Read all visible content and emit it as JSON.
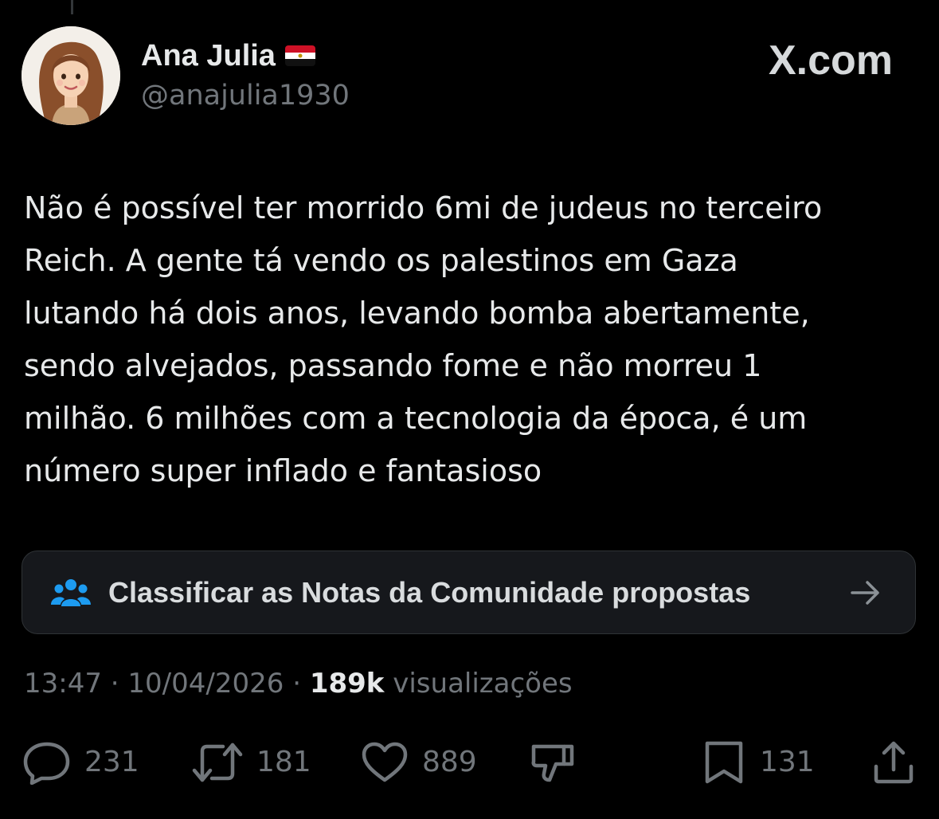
{
  "post": {
    "display_name": "Ana Julia",
    "handle": "@anajulia1930",
    "brand": "X.com",
    "text": "Não é possível ter morrido 6mi de judeus no terceiro\nReich. A gente tá vendo os palestinos em Gaza\nlutando há dois anos, levando bomba abertamente,\nsendo alvejados, passando fome e não morreu 1\nmilhão. 6 milhões com a tecnologia da época, é um\nnúmero super inflado e fantasioso"
  },
  "community_notes": {
    "label": "Classificar as Notas da Comunidade propostas"
  },
  "meta": {
    "time": "13:47",
    "separator": "·",
    "date": "10/04/2026",
    "views_count": "189k",
    "views_label": "visualizações"
  },
  "actions": {
    "replies": "231",
    "reposts": "181",
    "likes": "889",
    "bookmarks": "131"
  },
  "colors": {
    "background": "#000000",
    "text_primary": "#e7e9ea",
    "text_secondary": "#71767b",
    "accent_blue": "#1d9bf0",
    "card_background": "#16181c",
    "card_border": "#2f3336"
  },
  "icons": {
    "flag": "egypt-flag-icon",
    "community": "community-notes-icon",
    "arrow": "arrow-right-icon",
    "reply": "reply-icon",
    "repost": "repost-icon",
    "like": "heart-icon",
    "dislike": "downvote-icon",
    "bookmark": "bookmark-icon",
    "share": "share-icon"
  }
}
